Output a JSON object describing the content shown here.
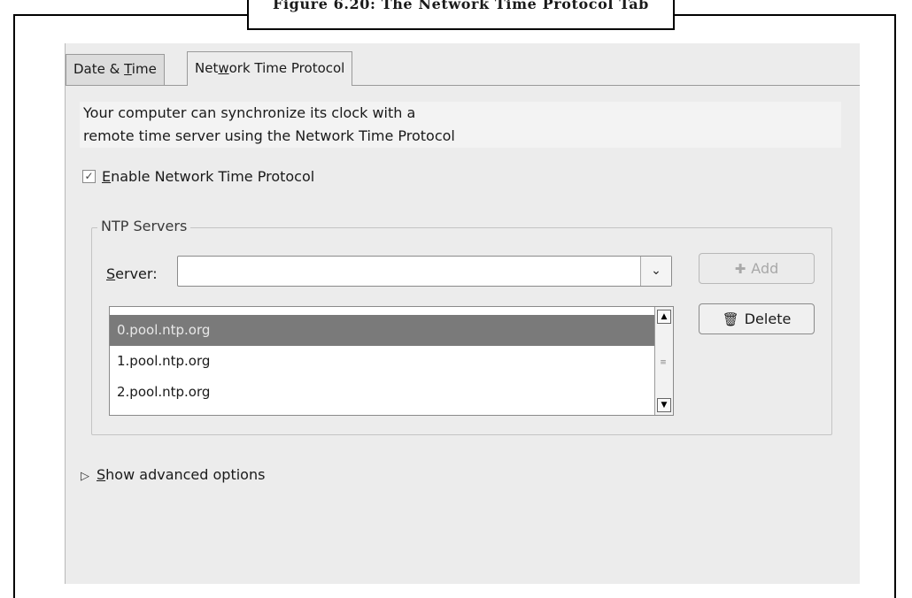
{
  "figure": {
    "caption": "Figure 6.20: The Network Time Protocol Tab"
  },
  "tabs": [
    {
      "label": "Date & Time",
      "mnemonic": "T"
    },
    {
      "label": "Network Time Protocol",
      "mnemonic": "w",
      "active": true
    }
  ],
  "description": {
    "line1": "Your computer can synchronize its clock with a",
    "line2": "remote time server using the Network Time Protocol"
  },
  "enable_ntp": {
    "label": "Enable Network Time Protocol",
    "checked": true
  },
  "ntp_servers": {
    "legend": "NTP Servers",
    "server_label": "Server:",
    "server_value": "",
    "add_label": "Add",
    "add_enabled": false,
    "delete_label": "Delete",
    "servers": [
      "0.pool.ntp.org",
      "1.pool.ntp.org",
      "2.pool.ntp.org"
    ],
    "selected_index": 0
  },
  "advanced": {
    "label": "Show advanced options",
    "expanded": false
  },
  "icons": {
    "add": "plus-icon",
    "delete": "trash-icon",
    "expander": "triangle-right-icon",
    "combo": "chevron-down-icon"
  },
  "colors": {
    "selection": "#7a7a7a",
    "dialog_bg": "#ececec"
  }
}
